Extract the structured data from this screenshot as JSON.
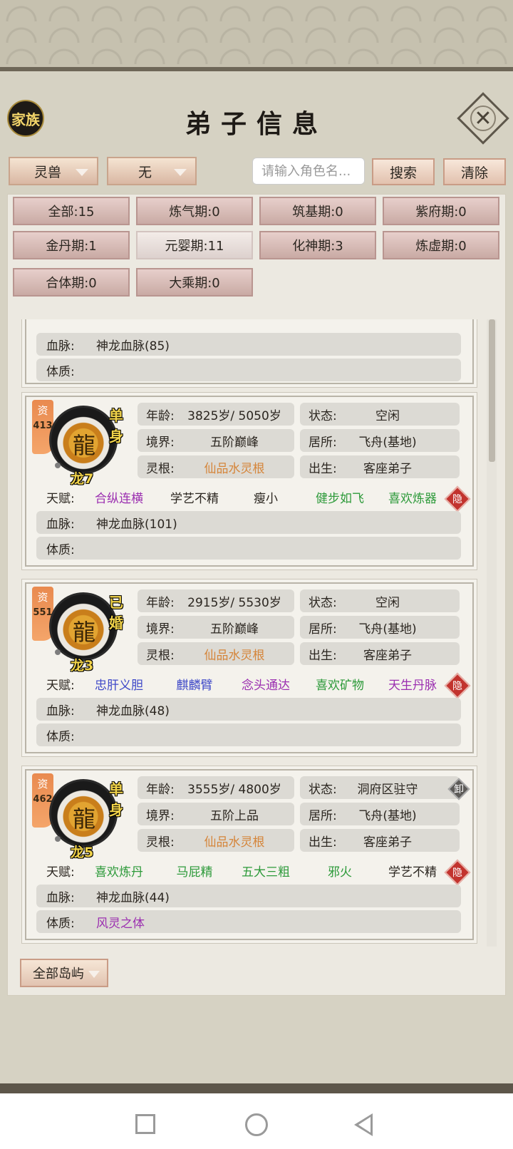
{
  "header": {
    "family_label": "家族",
    "title": "弟子信息",
    "close_glyph": "✕"
  },
  "filters": {
    "type_selected": "灵兽",
    "sub_selected": "无",
    "search_placeholder": "请输入角色名...",
    "search_label": "搜索",
    "clear_label": "清除"
  },
  "stages": [
    "全部:15",
    "炼气期:0",
    "筑基期:0",
    "紫府期:0",
    "金丹期:1",
    "元婴期:11",
    "化神期:3",
    "炼虚期:0",
    "合体期:0",
    "大乘期:0"
  ],
  "partial_card": {
    "bloodline_label": "血脉:",
    "bloodline": "神龙血脉(85)",
    "physique_label": "体质:"
  },
  "labels": {
    "age": "年龄:",
    "realm": "境界:",
    "root": "灵根:",
    "status": "状态:",
    "residence": "居所:",
    "origin": "出生:",
    "talent": "天赋:",
    "bloodline": "血脉:",
    "physique": "体质:",
    "zi": "资",
    "hide": "隐",
    "unload": "卸"
  },
  "disciples": [
    {
      "zi_value": "413",
      "marital": "单身",
      "name": "龙7",
      "age": "3825岁/ 5050岁",
      "realm": "五阶巅峰",
      "root": "仙品水灵根",
      "status": "空闲",
      "residence": "飞舟(基地)",
      "origin": "客座弟子",
      "talents": [
        "合纵连横",
        "学艺不精",
        "瘦小",
        "健步如飞",
        "喜欢炼器"
      ],
      "talent_colors": [
        "purple",
        "dark",
        "dark",
        "green",
        "green"
      ],
      "bloodline": "神龙血脉(101)",
      "physique": ""
    },
    {
      "zi_value": "551",
      "marital": "已婚",
      "name": "龙3",
      "age": "2915岁/ 5530岁",
      "realm": "五阶巅峰",
      "root": "仙品水灵根",
      "status": "空闲",
      "residence": "飞舟(基地)",
      "origin": "客座弟子",
      "talents": [
        "忠肝义胆",
        "麒麟臂",
        "念头通达",
        "喜欢矿物",
        "天生丹脉"
      ],
      "talent_colors": [
        "blue",
        "blue",
        "purple",
        "green",
        "purple"
      ],
      "bloodline": "神龙血脉(48)",
      "physique": ""
    },
    {
      "zi_value": "462",
      "marital": "单身",
      "name": "龙5",
      "age": "3555岁/ 4800岁",
      "realm": "五阶上品",
      "root": "仙品水灵根",
      "status": "洞府区驻守",
      "residence": "飞舟(基地)",
      "origin": "客座弟子",
      "talents": [
        "喜欢炼丹",
        "马屁精",
        "五大三粗",
        "邪火",
        "学艺不精"
      ],
      "talent_colors": [
        "green",
        "green",
        "green",
        "green",
        "dark"
      ],
      "bloodline": "神龙血脉(44)",
      "physique": "风灵之体"
    }
  ],
  "footer": {
    "island_selected": "全部岛屿"
  },
  "colors": {
    "purple": "#9b2fb0",
    "green": "#2d9a3a",
    "blue": "#3f49c8",
    "orange": "#d5853a",
    "badge_red": "#c2332e"
  }
}
